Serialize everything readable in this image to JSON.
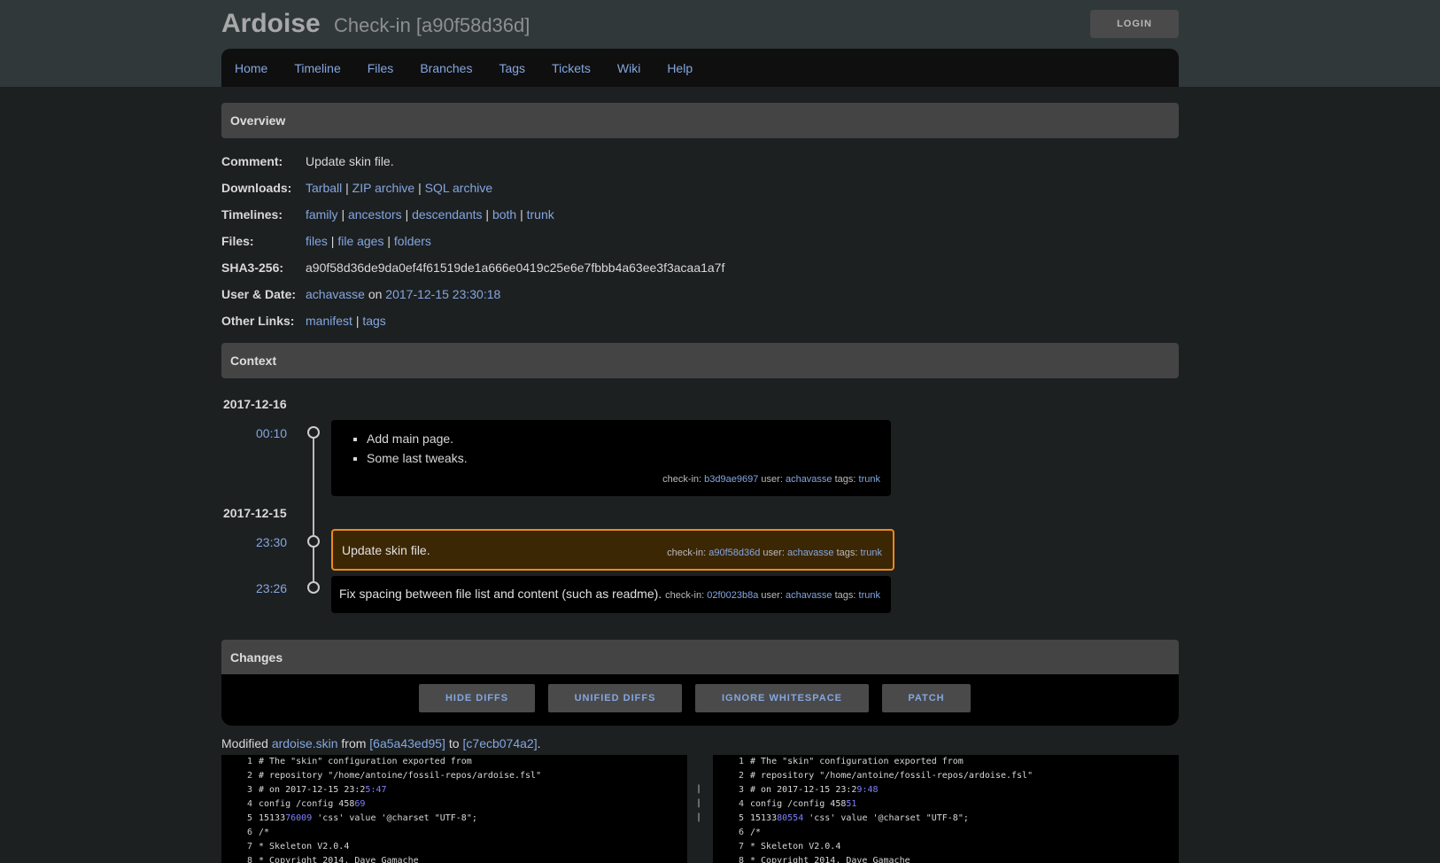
{
  "header": {
    "brand": "Ardoise",
    "title": "Check-in [a90f58d36d]",
    "login": "LOGIN"
  },
  "nav": [
    "Home",
    "Timeline",
    "Files",
    "Branches",
    "Tags",
    "Tickets",
    "Wiki",
    "Help"
  ],
  "overview": {
    "heading": "Overview",
    "comment_label": "Comment:",
    "comment": "Update skin file.",
    "downloads_label": "Downloads:",
    "downloads": [
      "Tarball",
      "ZIP archive",
      "SQL archive"
    ],
    "timelines_label": "Timelines:",
    "timelines": [
      "family",
      "ancestors",
      "descendants",
      "both",
      "trunk"
    ],
    "files_label": "Files:",
    "files": [
      "files",
      "file ages",
      "folders"
    ],
    "sha_label": "SHA3-256:",
    "sha": "a90f58d36de9da0ef4f61519de1a666e0419c25e6e7fbbb4a63ee3f3acaa1a7f",
    "userdate_label": "User & Date:",
    "user": "achavasse",
    "on": "on",
    "date": "2017-12-15 23:30:18",
    "other_label": "Other Links:",
    "other": [
      "manifest",
      "tags"
    ],
    "sep": "|"
  },
  "context": {
    "heading": "Context",
    "dates": [
      "2017-12-16",
      "2017-12-15"
    ],
    "entries": [
      {
        "time": "00:10",
        "items": [
          "Add main page.",
          "Some last tweaks."
        ],
        "checkin": "b3d9ae9697",
        "user": "achavasse",
        "tag": "trunk"
      },
      {
        "time": "23:30",
        "text": "Update skin file.",
        "checkin": "a90f58d36d",
        "user": "achavasse",
        "tag": "trunk"
      },
      {
        "time": "23:26",
        "text": "Fix spacing between file list and content (such as readme).",
        "checkin": "02f0023b8a",
        "user": "achavasse",
        "tag": "trunk"
      }
    ],
    "labels": {
      "checkin": "check-in:",
      "user": "user:",
      "tags": "tags:"
    }
  },
  "changes": {
    "heading": "Changes",
    "buttons": [
      "HIDE DIFFS",
      "UNIFIED DIFFS",
      "IGNORE WHITESPACE",
      "PATCH"
    ],
    "modified": {
      "prefix": "Modified",
      "file": "ardoise.skin",
      "from": "from",
      "from_hash": "[6a5a43ed95]",
      "to": "to",
      "to_hash": "[c7ecb074a2]",
      "end": "."
    }
  },
  "diff": {
    "numbers": [
      "1",
      "2",
      "3",
      "4",
      "5",
      "6",
      "7",
      "8"
    ],
    "left": [
      [
        "# The \"skin\" configuration exported from",
        ""
      ],
      [
        "# repository \"/home/antoine/fossil-repos/ardoise.fsl\"",
        ""
      ],
      [
        "# on 2017-12-15 23:2",
        "5:47"
      ],
      [
        "config /config 458",
        "69"
      ],
      [
        "15133",
        "76009",
        " 'css' value '@charset \"UTF-8\";"
      ],
      [
        "/*",
        ""
      ],
      [
        "* Skeleton V2.0.4",
        ""
      ],
      [
        "* Copyright 2014, Dave Gamache",
        ""
      ]
    ],
    "right": [
      [
        "# The \"skin\" configuration exported from",
        ""
      ],
      [
        "# repository \"/home/antoine/fossil-repos/ardoise.fsl\"",
        ""
      ],
      [
        "# on 2017-12-15 23:2",
        "9:48"
      ],
      [
        "config /config 458",
        "51"
      ],
      [
        "15133",
        "80554",
        " 'css' value '@charset \"UTF-8\";"
      ],
      [
        "/*",
        ""
      ],
      [
        "* Skeleton V2.0.4",
        ""
      ],
      [
        "* Copyright 2014, Dave Gamache",
        ""
      ]
    ],
    "marker": "|"
  }
}
